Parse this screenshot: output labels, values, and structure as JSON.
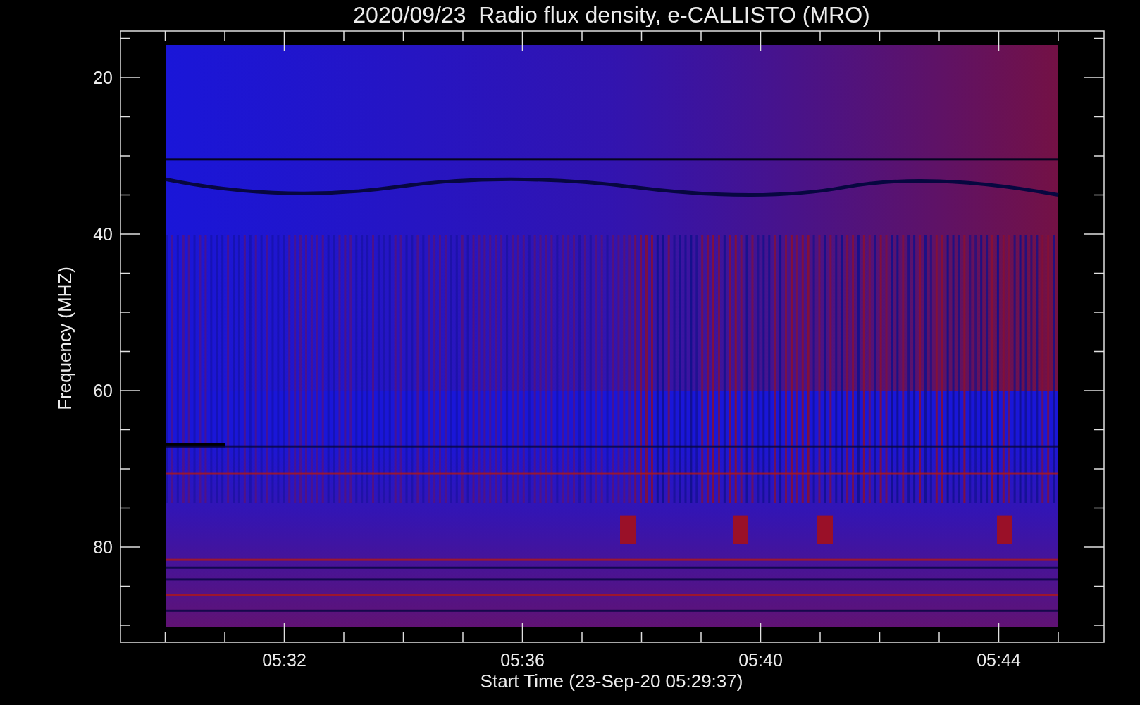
{
  "title": "2020/09/23  Radio flux density, e-CALLISTO (MRO)",
  "y_axis": {
    "label": "Frequency (MHZ)",
    "ticks": [
      "20",
      "40",
      "60",
      "80"
    ]
  },
  "x_axis": {
    "label": "Start Time (23-Sep-20 05:29:37)",
    "ticks": [
      "05:32",
      "05:36",
      "05:40",
      "05:44"
    ]
  }
}
